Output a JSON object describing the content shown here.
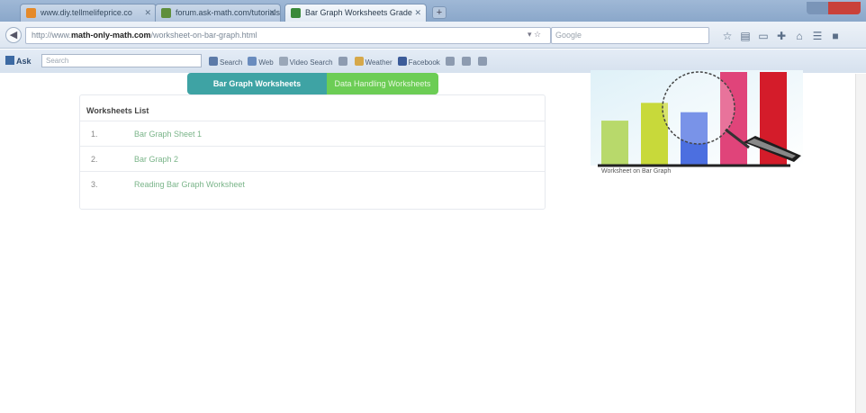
{
  "browser": {
    "tabs": [
      {
        "title": "www.diy.tellmelifeprice.co",
        "active": false,
        "color": "#e58a2a"
      },
      {
        "title": "forum.ask-math.com/tutorials",
        "active": false,
        "color": "#5f8f3c"
      },
      {
        "title": "Bar Graph Worksheets Grade",
        "active": true,
        "color": "#3a8a3a"
      }
    ],
    "new_tab": "+",
    "url_prefix": "http://www.",
    "url_bold": "math-only-math.com",
    "url_rest": "/worksheet-on-bar-graph.html",
    "url_dropdown": "▾ ☆",
    "search_placeholder": "Google",
    "nav_icons": [
      "home-icon",
      "bookmark-icon",
      "download-icon",
      "addon-icon",
      "house-icon",
      "menu-icon",
      "grid-icon"
    ]
  },
  "toolbar": {
    "logo": "Ask",
    "search_placeholder": "Search",
    "items": [
      {
        "label": "Search",
        "icon": "search-icon",
        "color": "#5c7aa8"
      },
      {
        "label": "Web",
        "icon": "web-icon",
        "color": "#6a8cbe"
      },
      {
        "label": "Video Search",
        "icon": "video-icon",
        "color": "#9aa7b8"
      },
      {
        "label": "",
        "icon": "doc-icon",
        "color": "#8d9bb0"
      },
      {
        "label": "Weather",
        "icon": "weather-icon",
        "color": "#d6a84a"
      },
      {
        "label": "Facebook",
        "icon": "facebook-icon",
        "color": "#3b5b99"
      },
      {
        "label": "",
        "icon": "mail-icon",
        "color": "#8d9bb0"
      },
      {
        "label": "",
        "icon": "settings-icon",
        "color": "#8d9bb0"
      },
      {
        "label": "",
        "icon": "help-icon",
        "color": "#8d9bb0"
      }
    ]
  },
  "banner": {
    "primary_label": "Bar Graph Worksheets",
    "secondary_label": "Data Handling Worksheets"
  },
  "panel": {
    "title": "Worksheets List",
    "rows": [
      {
        "num": "1.",
        "label": "Bar Graph Sheet 1"
      },
      {
        "num": "2.",
        "label": "Bar Graph 2"
      },
      {
        "num": "3.",
        "label": "Reading Bar Graph Worksheet"
      }
    ]
  },
  "illustration": {
    "caption": "Worksheet on Bar Graph",
    "bars": [
      {
        "value": 0.48,
        "color": "#b8d96b"
      },
      {
        "value": 0.67,
        "color": "#c8d93a"
      },
      {
        "value": 0.57,
        "color": "#4c6fe0"
      },
      {
        "value": 1.0,
        "color": "#e0447a"
      },
      {
        "value": 1.0,
        "color": "#d41c2a"
      }
    ]
  }
}
